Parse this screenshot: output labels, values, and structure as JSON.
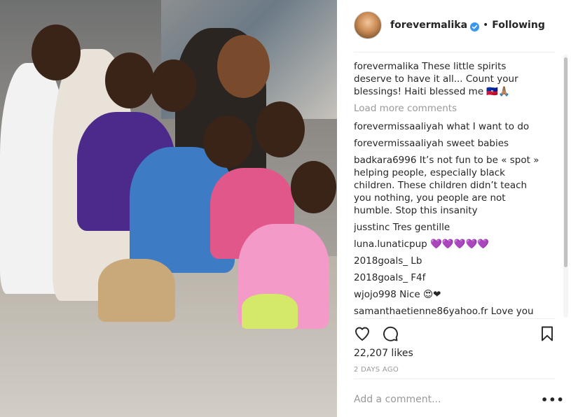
{
  "post": {
    "username": "forevermalika",
    "follow_status": "Following",
    "separator": "•",
    "likes_label": "22,207 likes",
    "date_label": "2 DAYS AGO"
  },
  "caption": {
    "username": "forevermalika",
    "text": "These little spirits deserve to have it all... Count your blessings! Haiti blessed me 🇭🇹🙏🏽"
  },
  "load_more_label": "Load more comments",
  "comments": [
    {
      "username": "forevermissaaliyah",
      "text": "what I want to do"
    },
    {
      "username": "forevermissaaliyah",
      "text": "sweet babies"
    },
    {
      "username": "badkara6996",
      "text": "It’s not fun to be « spot » helping people, especially black children. These children didn’t teach you nothing, you people are not humble. Stop this insanity"
    },
    {
      "username": "jusstinc",
      "text": "Tres gentille"
    },
    {
      "username": "luna.lunaticpup",
      "text": "💜💜💜💜💜"
    },
    {
      "username": "2018goals_",
      "text": "Lb"
    },
    {
      "username": "2018goals_",
      "text": "F4f"
    },
    {
      "username": "wjojo998",
      "text": "Nice 😍❤"
    },
    {
      "username": "samanthaetienne86yahoo.fr",
      "text": "Love you"
    }
  ],
  "add_comment": {
    "placeholder": "Add a comment...",
    "more_label": "•••"
  },
  "icons": {
    "like": "heart-icon",
    "comment": "comment-icon",
    "save": "bookmark-icon",
    "verified": "verified-badge-icon",
    "more": "more-options-icon"
  },
  "colors": {
    "verified_blue": "#3897f0",
    "muted_text": "#999999",
    "text": "#262626"
  }
}
